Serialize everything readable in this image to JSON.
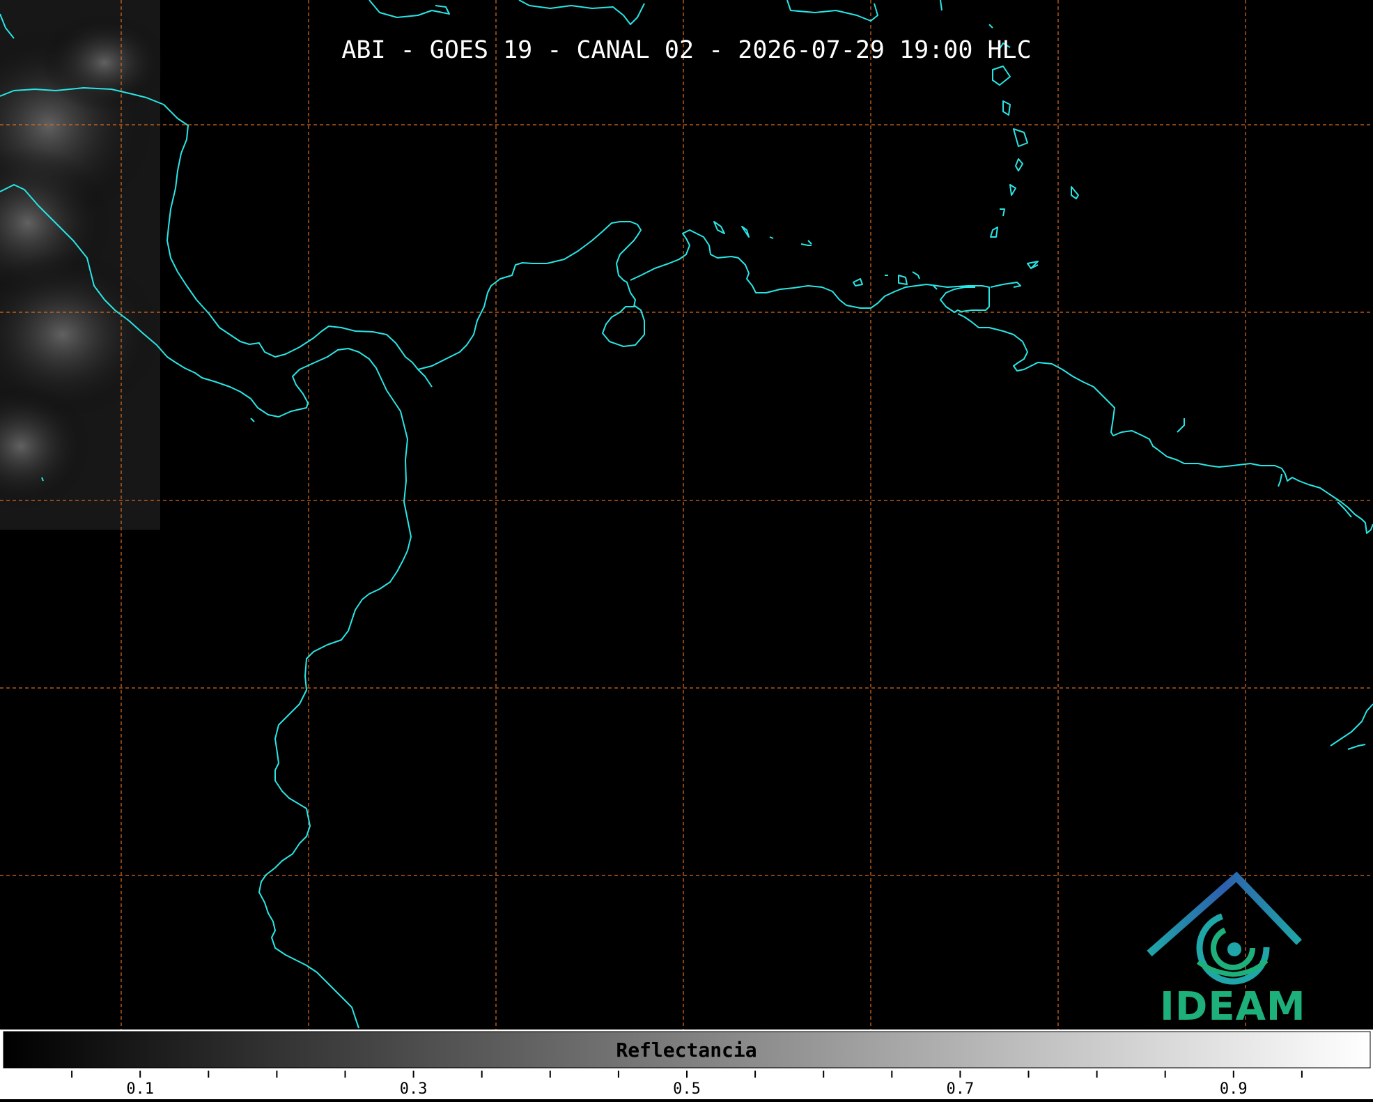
{
  "title": "ABI - GOES 19 - CANAL 02 - 2026-07-29 19:00 HLC",
  "colorbar": {
    "label": "Reflectancia",
    "ticks": [
      {
        "value": 0.1,
        "label": "0.1"
      },
      {
        "value": 0.3,
        "label": "0.3"
      },
      {
        "value": 0.5,
        "label": "0.5"
      },
      {
        "value": 0.7,
        "label": "0.7"
      },
      {
        "value": 0.9,
        "label": "0.9"
      }
    ],
    "range": [
      0.0,
      1.0
    ]
  },
  "logo": {
    "text": "IDEAM",
    "colors": {
      "blue": "#2d5fae",
      "teal": "#1fa6a8",
      "green": "#1db07a"
    }
  },
  "colors": {
    "background": "#000000",
    "coastline": "#29e6e6",
    "gridline": "#d2691e",
    "title_text": "#ffffff"
  }
}
